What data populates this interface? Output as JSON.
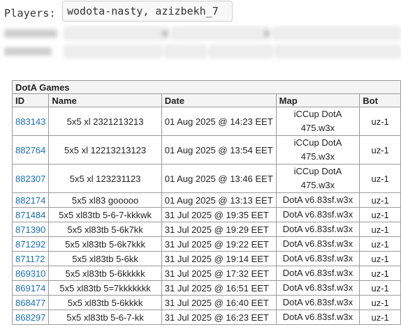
{
  "players": {
    "label": "Players:",
    "value": "wodota-nasty, azizbekh_7"
  },
  "table": {
    "caption": "DotA Games",
    "columns": [
      "ID",
      "Name",
      "Date",
      "Map",
      "Bot"
    ],
    "rows": [
      {
        "id": "883143",
        "name": "5x5 xl 2321213213",
        "date": "01 Aug 2025 @ 14:23 EET",
        "map_line1": "iCCup DotA",
        "map_line2": "475.w3x",
        "bot": "uz-1"
      },
      {
        "id": "882764",
        "name": "5x5 xl 12213213123",
        "date": "01 Aug 2025 @ 13:54 EET",
        "map_line1": "iCCup DotA",
        "map_line2": "475.w3x",
        "bot": "uz-1"
      },
      {
        "id": "882307",
        "name": "5x5 xl 123231123",
        "date": "01 Aug 2025 @ 13:46 EET",
        "map_line1": "iCCup DotA",
        "map_line2": "475.w3x",
        "bot": "uz-1"
      },
      {
        "id": "882174",
        "name": "5x5 xl83 gooooo",
        "date": "01 Aug 2025 @ 13:13 EET",
        "map_line1": "DotA v6.83sf.w3x",
        "map_line2": "",
        "bot": "uz-1"
      },
      {
        "id": "871484",
        "name": "5x5 xl83tb 5-6-7-kkkwk",
        "date": "31 Jul 2025 @ 19:35 EET",
        "map_line1": "DotA v6.83sf.w3x",
        "map_line2": "",
        "bot": "uz-1"
      },
      {
        "id": "871390",
        "name": "5x5 xl83tb 5-6k7kk",
        "date": "31 Jul 2025 @ 19:29 EET",
        "map_line1": "DotA v6.83sf.w3x",
        "map_line2": "",
        "bot": "uz-1"
      },
      {
        "id": "871292",
        "name": "5x5 xl83tb 5-6k7kkk",
        "date": "31 Jul 2025 @ 19:22 EET",
        "map_line1": "DotA v6.83sf.w3x",
        "map_line2": "",
        "bot": "uz-1"
      },
      {
        "id": "871172",
        "name": "5x5 xl83tb 5-6kk",
        "date": "31 Jul 2025 @ 19:14 EET",
        "map_line1": "DotA v6.83sf.w3x",
        "map_line2": "",
        "bot": "uz-1"
      },
      {
        "id": "869310",
        "name": "5x5 xl83tb 5-6kkkkk",
        "date": "31 Jul 2025 @ 17:32 EET",
        "map_line1": "DotA v6.83sf.w3x",
        "map_line2": "",
        "bot": "uz-1"
      },
      {
        "id": "869174",
        "name": "5x5 xl83tb 5=7kkkkkkk",
        "date": "31 Jul 2025 @ 16:51 EET",
        "map_line1": "DotA v6.83sf.w3x",
        "map_line2": "",
        "bot": "uz-1"
      },
      {
        "id": "868477",
        "name": "5x5 xl83tb 5-6kkkk",
        "date": "31 Jul 2025 @ 16:40 EET",
        "map_line1": "DotA v6.83sf.w3x",
        "map_line2": "",
        "bot": "uz-1"
      },
      {
        "id": "868297",
        "name": "5x5 xl83tb 5-6-7-kk",
        "date": "31 Jul 2025 @ 16:23 EET",
        "map_line1": "DotA v6.83sf.w3x",
        "map_line2": "",
        "bot": "uz-1"
      }
    ]
  },
  "colors": {
    "link": "#1a6fb5",
    "border": "#9a9a9a",
    "header_bg": "#f4f4f4"
  }
}
